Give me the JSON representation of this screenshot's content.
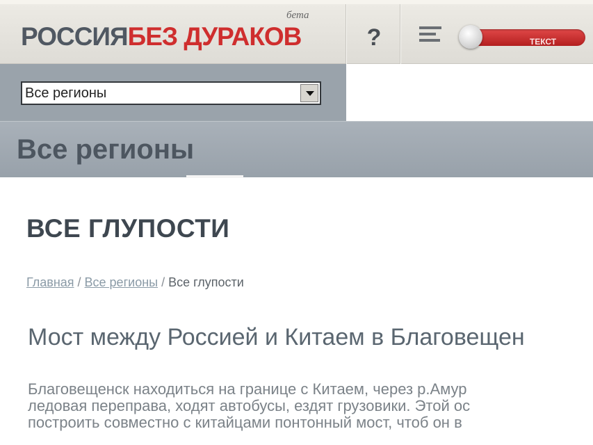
{
  "header": {
    "logo_part1": "РОССИЯ",
    "logo_part2": "БЕЗ ДУРАКОВ",
    "logo_beta": "бета",
    "help_label": "?",
    "menu_icon": "list-icon",
    "toggle_label": "ТЕКСТ"
  },
  "region": {
    "selected": "Все регионы"
  },
  "band": {
    "title": "Все регионы"
  },
  "content": {
    "page_title": "ВСЕ ГЛУПОСТИ",
    "breadcrumb": {
      "home": "Главная",
      "sep1": " / ",
      "regions": "Все регионы",
      "sep2": " / ",
      "current": "Все глупости"
    },
    "article_title": "Мост между Россией и Китаем в Благовещен",
    "article_lines": [
      "Благовещенск находиться на границе с Китаем, через р.Амур",
      "ледовая переправа, ходят автобусы, ездят грузовики. Этой ос",
      "построить совместно с китайцами понтонный мост, чтоб он в"
    ]
  },
  "colors": {
    "brand_red": "#cf2e2e",
    "logo_gray": "#505862",
    "band_bg": "#9aa3ab"
  }
}
